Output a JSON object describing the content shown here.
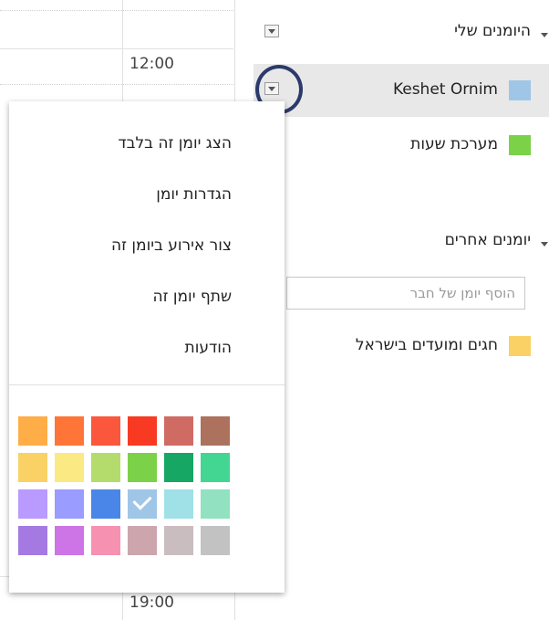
{
  "grid": {
    "times": [
      "12:00",
      "19:00"
    ]
  },
  "my_calendars": {
    "title": "היומנים שלי",
    "items": [
      {
        "name": "Keshet Ornim",
        "color": "#9fc6e7",
        "selected": true
      },
      {
        "name": "מערכת שעות",
        "color": "#7bd148",
        "selected": false
      }
    ]
  },
  "other_calendars": {
    "title": "יומנים אחרים",
    "add_placeholder": "הוסף יומן של חבר",
    "items": [
      {
        "name": "חגים ומועדים בישראל",
        "color": "#fad165"
      }
    ]
  },
  "menu": {
    "items": [
      "הצג יומן זה בלבד",
      "הגדרות יומן",
      "צור אירוע ביומן זה",
      "שתף יומן זה",
      "הודעות"
    ],
    "palette": [
      [
        "#ac725e",
        "#d06b64",
        "#f83a22",
        "#fa573c",
        "#ff7537",
        "#ffad46"
      ],
      [
        "#42d692",
        "#16a765",
        "#7bd148",
        "#b3dc6c",
        "#fbe983",
        "#fad165"
      ],
      [
        "#92e1c0",
        "#9fe1e7",
        "#9fc6e7",
        "#4986e7",
        "#9a9cff",
        "#b99aff"
      ],
      [
        "#c2c2c2",
        "#cabdbf",
        "#cca6ac",
        "#f691b2",
        "#cd74e6",
        "#a47ae2"
      ]
    ],
    "selected_color": "#9fc6e7"
  }
}
